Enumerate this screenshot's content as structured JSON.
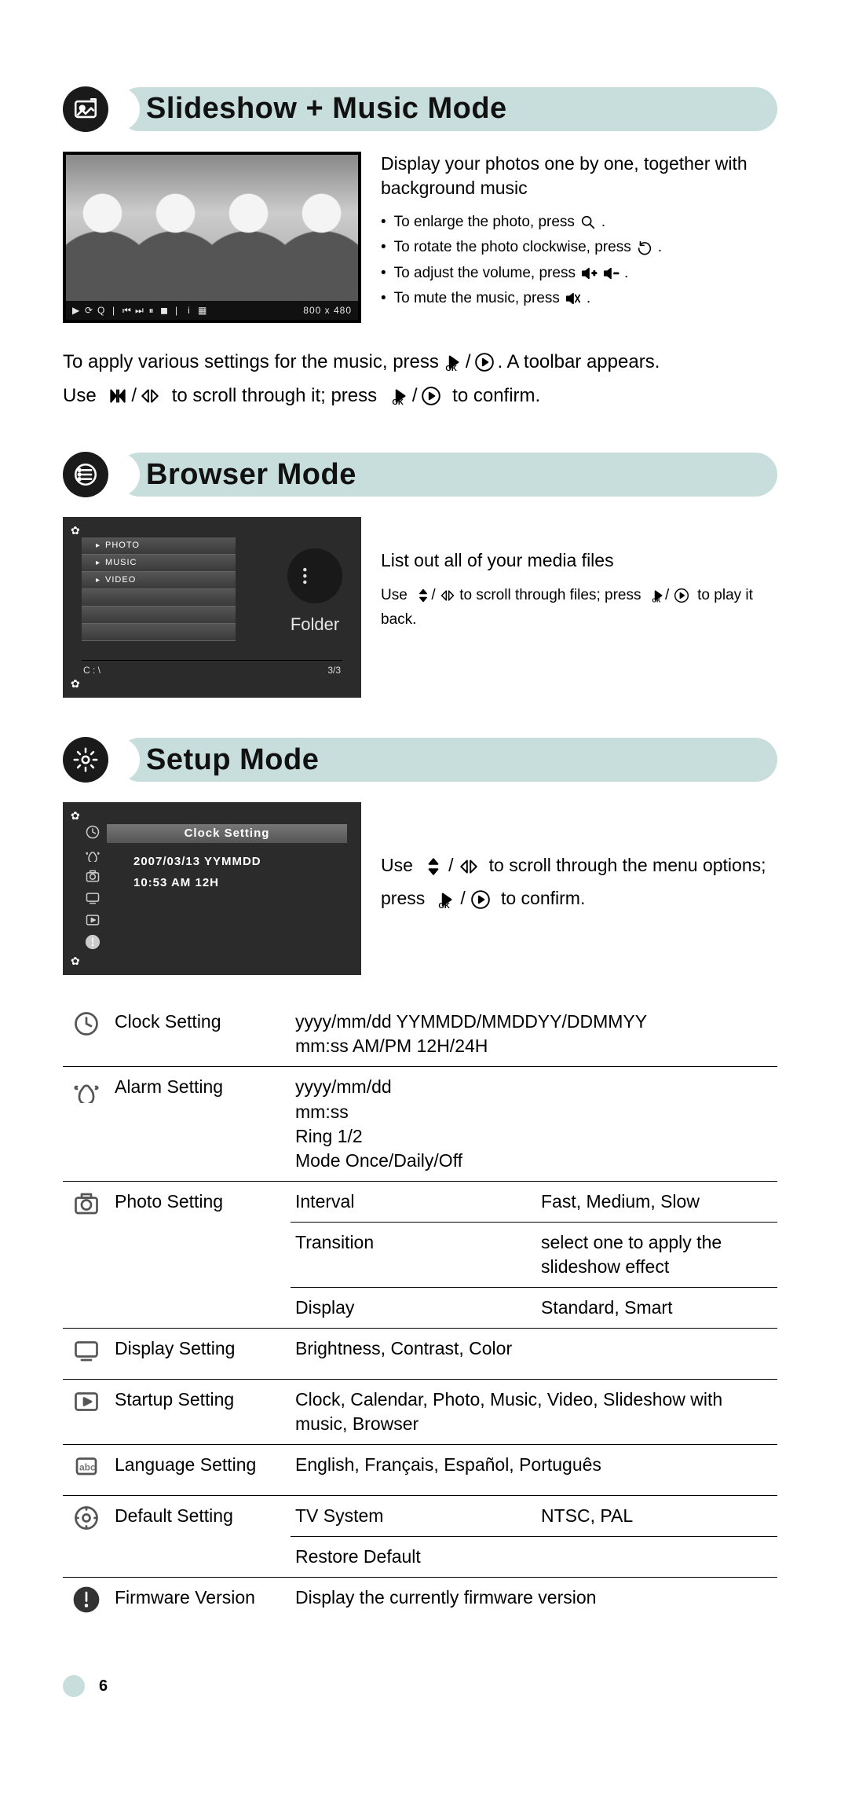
{
  "page_number": "6",
  "sections": {
    "slideshow": {
      "title": "Slideshow + Music Mode",
      "playbar_res": "800 x 480",
      "intro": "Display your photos one by one, together with background music",
      "bullets": {
        "enlarge_pre": "To enlarge the photo, press",
        "rotate_pre": "To rotate the photo clockwise, press",
        "volume_pre": "To adjust the volume, press",
        "mute_pre": "To mute the music, press"
      },
      "para1_a": "To apply various settings for the music, press",
      "para1_b": ". A toolbar appears.",
      "para2_a": "Use",
      "para2_b": "to scroll through it; press",
      "para2_c": "to confirm."
    },
    "browser": {
      "title": "Browser Mode",
      "folder_label": "Folder",
      "menu_items": [
        "PHOTO",
        "MUSIC",
        "VIDEO"
      ],
      "path": "C : \\",
      "counter": "3/3",
      "caption": "List out all of your media files",
      "hint_a": "Use",
      "hint_b": "to scroll through files; press",
      "hint_c": "to play it back."
    },
    "setup": {
      "title": "Setup Mode",
      "panel_title": "Clock Setting",
      "date_line": "2007/03/13 YYMMDD",
      "time_line": "10:53 AM   12H",
      "caption_a": "Use",
      "caption_b": "to scroll through the menu options; press",
      "caption_c": "to confirm."
    }
  },
  "settings": {
    "clock": {
      "name": "Clock Setting",
      "c2": "yyyy/mm/dd    YYMMDD/MMDDYY/DDMMYY\nmm:ss   AM/PM  12H/24H"
    },
    "alarm": {
      "name": "Alarm Setting",
      "c2": "yyyy/mm/dd\nmm:ss\nRing     1/2\nMode     Once/Daily/Off"
    },
    "photo": {
      "name": "Photo Setting",
      "rows": [
        {
          "a": "Interval",
          "b": "Fast, Medium, Slow"
        },
        {
          "a": "Transition",
          "b": "select one to apply the slideshow effect"
        },
        {
          "a": "Display",
          "b": "Standard, Smart"
        }
      ]
    },
    "display": {
      "name": "Display Setting",
      "c2": "Brightness, Contrast, Color"
    },
    "startup": {
      "name": "Startup Setting",
      "c2": "Clock, Calendar, Photo, Music, Video, Slideshow with music, Browser"
    },
    "language": {
      "name": "Language Setting",
      "c2": "English, Français, Español, Português"
    },
    "default": {
      "name": "Default Setting",
      "rows": [
        {
          "a": "TV System",
          "b": "NTSC, PAL"
        },
        {
          "a": "Restore Default",
          "b": ""
        }
      ]
    },
    "firmware": {
      "name": "Firmware Version",
      "c2": "Display the currently firmware version"
    }
  }
}
